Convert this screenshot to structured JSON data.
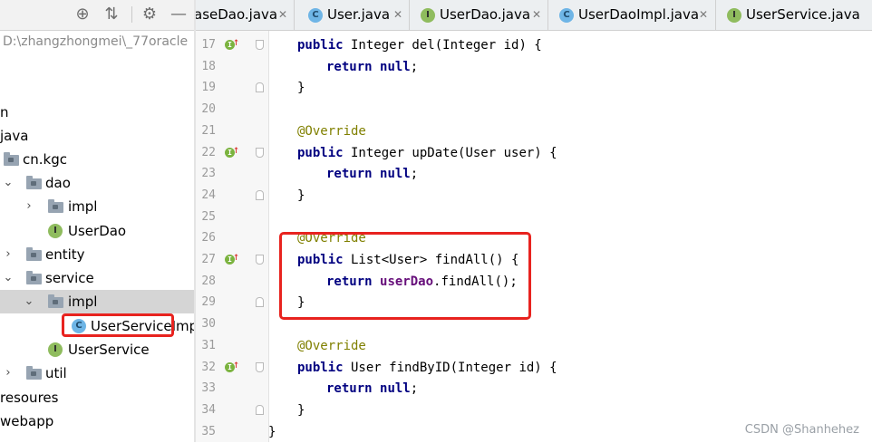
{
  "project_panel": {
    "path": "D:\\zhangzhongmei\\_77oracle",
    "tree": [
      {
        "label": "n",
        "type": "text"
      },
      {
        "label": "java",
        "type": "text"
      },
      {
        "label": "cn.kgc",
        "type": "package"
      },
      {
        "label": "dao",
        "type": "package",
        "expanded": true
      },
      {
        "label": "impl",
        "type": "package",
        "expanded": false
      },
      {
        "label": "UserDao",
        "type": "interface",
        "badge": "I"
      },
      {
        "label": "entity",
        "type": "package",
        "expanded": false
      },
      {
        "label": "service",
        "type": "package",
        "expanded": true
      },
      {
        "label": "impl",
        "type": "package",
        "expanded": true,
        "selected": true
      },
      {
        "label": "UserServiceImpl",
        "type": "class",
        "badge": "C"
      },
      {
        "label": "UserService",
        "type": "interface",
        "badge": "I"
      },
      {
        "label": "util",
        "type": "package",
        "expanded": false
      },
      {
        "label": "resoures",
        "type": "text"
      },
      {
        "label": "webapp",
        "type": "text"
      }
    ]
  },
  "tabs": [
    {
      "label": "aseDao.java",
      "icon": "none"
    },
    {
      "label": "User.java",
      "icon": "class-icon",
      "badge": "C"
    },
    {
      "label": "UserDao.java",
      "icon": "interface-icon",
      "badge": "I"
    },
    {
      "label": "UserDaoImpl.java",
      "icon": "class-icon",
      "badge": "C"
    },
    {
      "label": "UserService.java",
      "icon": "interface-icon",
      "badge": "I"
    }
  ],
  "editor": {
    "lines": [
      {
        "n": "17",
        "code": "public Integer del(Integer id) {"
      },
      {
        "n": "18",
        "code": "return null;"
      },
      {
        "n": "19",
        "code": "}"
      },
      {
        "n": "20",
        "code": ""
      },
      {
        "n": "21",
        "code": "@Override"
      },
      {
        "n": "22",
        "code": "public Integer upDate(User user) {"
      },
      {
        "n": "23",
        "code": "return null;"
      },
      {
        "n": "24",
        "code": "}"
      },
      {
        "n": "25",
        "code": ""
      },
      {
        "n": "26",
        "code": "@Override"
      },
      {
        "n": "27",
        "code": "public List<User> findAll() {"
      },
      {
        "n": "28",
        "code": "return userDao.findAll();"
      },
      {
        "n": "29",
        "code": "}"
      },
      {
        "n": "30",
        "code": ""
      },
      {
        "n": "31",
        "code": "@Override"
      },
      {
        "n": "32",
        "code": "public User findByID(Integer id) {"
      },
      {
        "n": "33",
        "code": "return null;"
      },
      {
        "n": "34",
        "code": "}"
      },
      {
        "n": "35",
        "code": "}"
      }
    ]
  },
  "watermark": "CSDN @Shanhehez",
  "colors": {
    "highlight_box": "#e8231f",
    "keyword": "#000080",
    "annotation": "#808000",
    "field": "#660e7a"
  }
}
